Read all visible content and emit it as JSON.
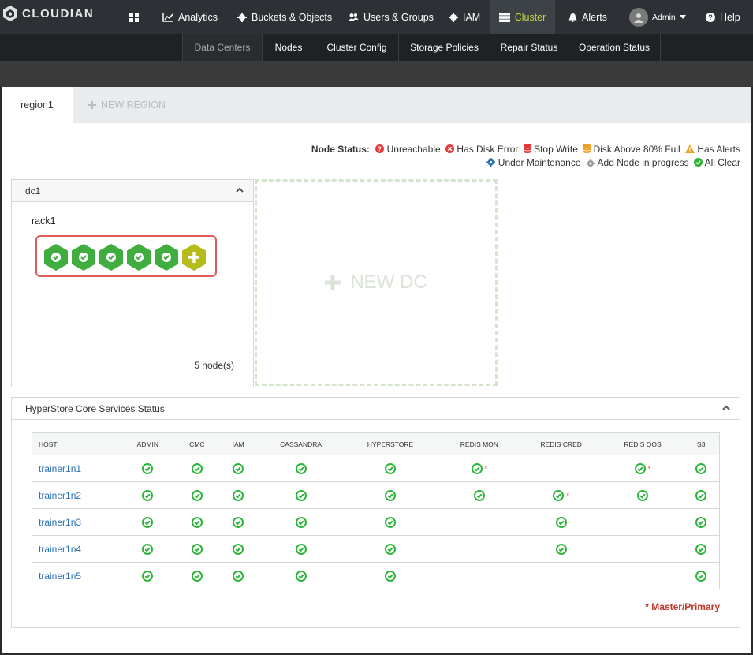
{
  "brand": {
    "name": "CLOUDIAN"
  },
  "nav": {
    "dashboard_icon": "grid-icon",
    "items": [
      {
        "label": "Analytics",
        "icon": "chart-icon"
      },
      {
        "label": "Buckets & Objects",
        "icon": "gear-icon"
      },
      {
        "label": "Users & Groups",
        "icon": "users-icon"
      },
      {
        "label": "IAM",
        "icon": "gear-icon"
      },
      {
        "label": "Cluster",
        "icon": "cluster-icon",
        "active": true
      },
      {
        "label": "Alerts",
        "icon": "bell-icon"
      },
      {
        "label": "Admin",
        "icon": "avatar"
      },
      {
        "label": "Help",
        "icon": "help-icon"
      }
    ]
  },
  "subnav": {
    "items": [
      "Data Centers",
      "Nodes",
      "Cluster Config",
      "Storage Policies",
      "Repair Status",
      "Operation Status"
    ],
    "active": "Data Centers"
  },
  "tabs": {
    "active": "region1",
    "new": "NEW REGION"
  },
  "legend": {
    "title": "Node Status:",
    "items": [
      "Unreachable",
      "Has Disk Error",
      "Stop Write",
      "Disk Above 80% Full",
      "Has Alerts",
      "Under Maintenance",
      "Add Node in progress",
      "All Clear"
    ],
    "colors": {
      "unreachable": "#e53935",
      "disk_error": "#e53935",
      "stop_write": "#e53935",
      "disk_full": "#f0a020",
      "alerts": "#f0a020",
      "maintenance": "#2a6fb5",
      "add_node": "#999999",
      "clear": "#2db53a"
    }
  },
  "dc": {
    "name": "dc1",
    "rack": "rack1",
    "node_count": "5 node(s)"
  },
  "new_dc": "NEW DC",
  "services": {
    "title": "HyperStore Core Services Status",
    "columns": [
      "HOST",
      "ADMIN",
      "CMC",
      "IAM",
      "CASSANDRA",
      "HYPERSTORE",
      "REDIS MON",
      "REDIS CRED",
      "REDIS QOS",
      "S3"
    ],
    "rows": [
      {
        "host": "trainer1n1",
        "cells": [
          "ok",
          "ok",
          "ok",
          "ok",
          "ok",
          "ok*",
          "",
          "ok*",
          "ok"
        ]
      },
      {
        "host": "trainer1n2",
        "cells": [
          "ok",
          "ok",
          "ok",
          "ok",
          "ok",
          "ok",
          "ok*",
          "ok",
          "ok"
        ]
      },
      {
        "host": "trainer1n3",
        "cells": [
          "ok",
          "ok",
          "ok",
          "ok",
          "ok",
          "",
          "ok",
          "",
          "ok"
        ]
      },
      {
        "host": "trainer1n4",
        "cells": [
          "ok",
          "ok",
          "ok",
          "ok",
          "ok",
          "",
          "ok",
          "",
          "ok"
        ]
      },
      {
        "host": "trainer1n5",
        "cells": [
          "ok",
          "ok",
          "ok",
          "ok",
          "ok",
          "",
          "",
          "",
          "ok"
        ]
      }
    ],
    "note": "* Master/Primary"
  },
  "colors": {
    "accent": "#c8d43c",
    "ok_green": "#2db53a",
    "hex_green": "#3fae3f",
    "hex_add": "#b5bb1a"
  }
}
